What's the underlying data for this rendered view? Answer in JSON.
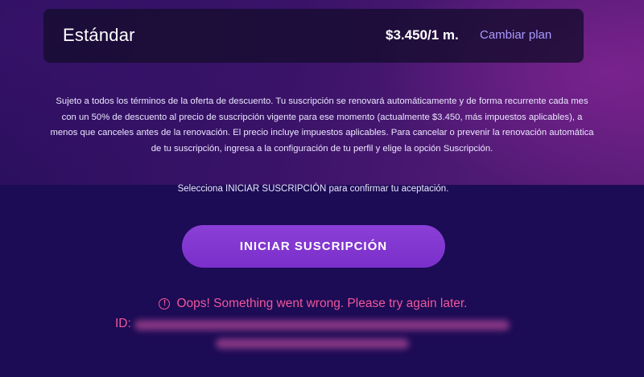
{
  "plan": {
    "name": "Estándar",
    "price": "$3.450/1 m.",
    "change_link": "Cambiar plan"
  },
  "terms": {
    "text": "Sujeto a todos los términos de la oferta de descuento. Tu suscripción se renovará automáticamente y de forma recurrente cada mes con un 50% de descuento al precio de suscripción vigente para ese momento (actualmente $3.450, más impuestos aplicables), a menos que canceles antes de la renovación. El precio incluye impuestos aplicables. Para cancelar o prevenir la renovación automática de tu suscripción, ingresa a la configuración de tu perfil y elige la opción Suscripción."
  },
  "confirm": {
    "text": "Selecciona INICIAR SUSCRIPCIÓN para confirmar tu aceptación."
  },
  "actions": {
    "start_label": "INICIAR SUSCRIPCIÓN"
  },
  "error": {
    "icon": "error-circle-icon",
    "icon_glyph": "!",
    "message": "Oops! Something went wrong. Please try again later.",
    "id_label": "ID:"
  },
  "colors": {
    "accent": "#7a2fcb",
    "link": "#a99aff",
    "error": "#f0579a",
    "background": "#1c0b55"
  }
}
